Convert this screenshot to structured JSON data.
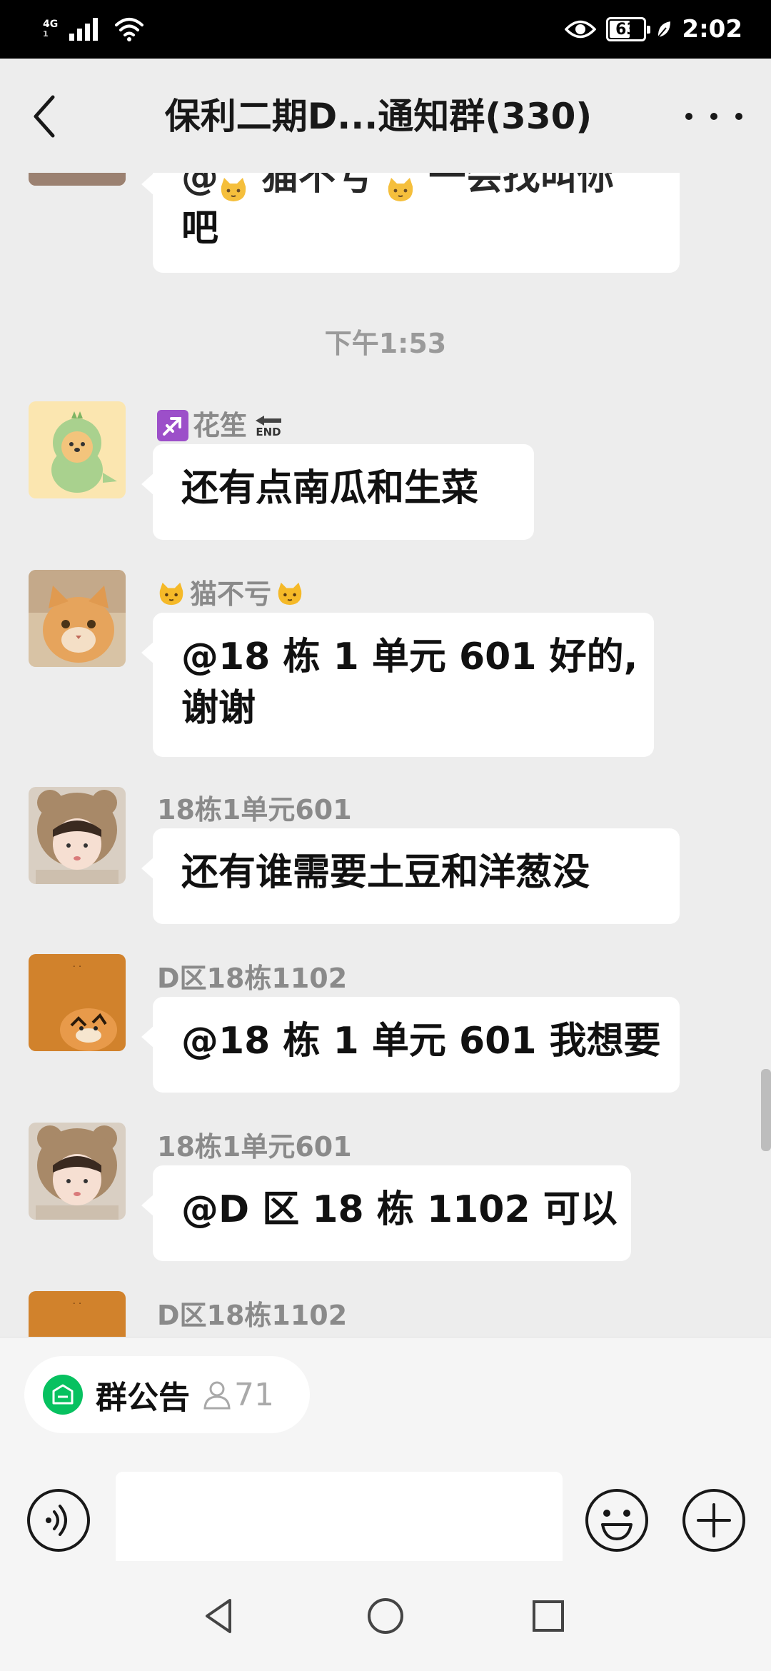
{
  "status_bar": {
    "network_top": "4G",
    "network_bottom": "1",
    "battery": "63",
    "battery_level": 0.63,
    "time": "2:02",
    "icons": [
      "signal-icon",
      "wifi-icon",
      "eye-icon",
      "battery-icon",
      "leaf-icon"
    ]
  },
  "header": {
    "title": "保利二期D...通知群(330)",
    "icons": [
      "back-arrow-icon",
      "more-dots-icon"
    ]
  },
  "chat": {
    "partial_message": {
      "line1_prefix": "@",
      "line1_name": " 猫不亏 ",
      "line1_suffix": " 一会找叫你",
      "line2": "吧"
    },
    "timestamp": "下午1:53",
    "messages": [
      {
        "sender": "花笙",
        "sender_prefix_icon": "sagittarius-emoji",
        "sender_suffix_icon": "end-arrow-emoji",
        "end_label": "END",
        "text": "还有点南瓜和生菜",
        "avatar": "green-dino-dog-avatar"
      },
      {
        "sender": " 猫不亏",
        "sender_icon": "cat-emoji",
        "text_line1": "@18 栋 1 单元 601  好的,",
        "text_line2": "谢谢",
        "avatar": "orange-cat-avatar"
      },
      {
        "sender": "18栋1单元601",
        "text": "还有谁需要土豆和洋葱没",
        "avatar": "girl-bear-hat-avatar"
      },
      {
        "sender": "D区18栋1102",
        "text": "@18 栋 1 单元 601  我想要",
        "avatar": "tiger-avatar"
      },
      {
        "sender": "18栋1单元601",
        "text": "@D 区 18 栋 1102  可以",
        "avatar": "girl-bear-hat-avatar"
      },
      {
        "sender": "D区18栋1102",
        "avatar": "tiger-avatar"
      }
    ]
  },
  "bottom": {
    "notice_label": "群公告",
    "notice_count": "71",
    "icons": [
      "voice-icon",
      "emoji-icon",
      "plus-icon",
      "person-icon"
    ]
  },
  "nav": {
    "icons": [
      "nav-back-icon",
      "nav-home-icon",
      "nav-recents-icon"
    ]
  },
  "colors": {
    "background": "#ededed",
    "bubble": "#ffffff",
    "accent_green": "#07c160",
    "sender_gray": "#8a8a8a"
  }
}
